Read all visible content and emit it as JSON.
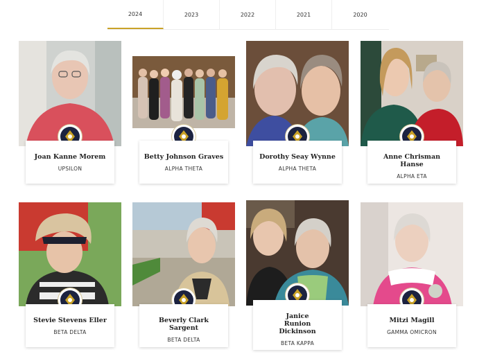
{
  "years": [
    "2024",
    "2023",
    "2022",
    "2021",
    "2020"
  ],
  "active_year": "2024",
  "accent_color": "#c9a227",
  "members": [
    {
      "name": "Joan Kanne Morem",
      "chapter": "UPSILON"
    },
    {
      "name": "Betty Johnson Graves",
      "chapter": "ALPHA THETA"
    },
    {
      "name": "Dorothy Seay Wynne",
      "chapter": "ALPHA THETA"
    },
    {
      "name": "Anne Chrisman Hanse",
      "chapter": "ALPHA ETA"
    },
    {
      "name": "Stevie Stevens Eller",
      "chapter": "BETA DELTA"
    },
    {
      "name": "Beverly Clark Sargent",
      "chapter": "BETA DELTA"
    },
    {
      "name": "Janice Runion Dickinson",
      "chapter": "BETA KAPPA"
    },
    {
      "name": "Mitzi Magill",
      "chapter": "GAMMA OMICRON"
    }
  ]
}
